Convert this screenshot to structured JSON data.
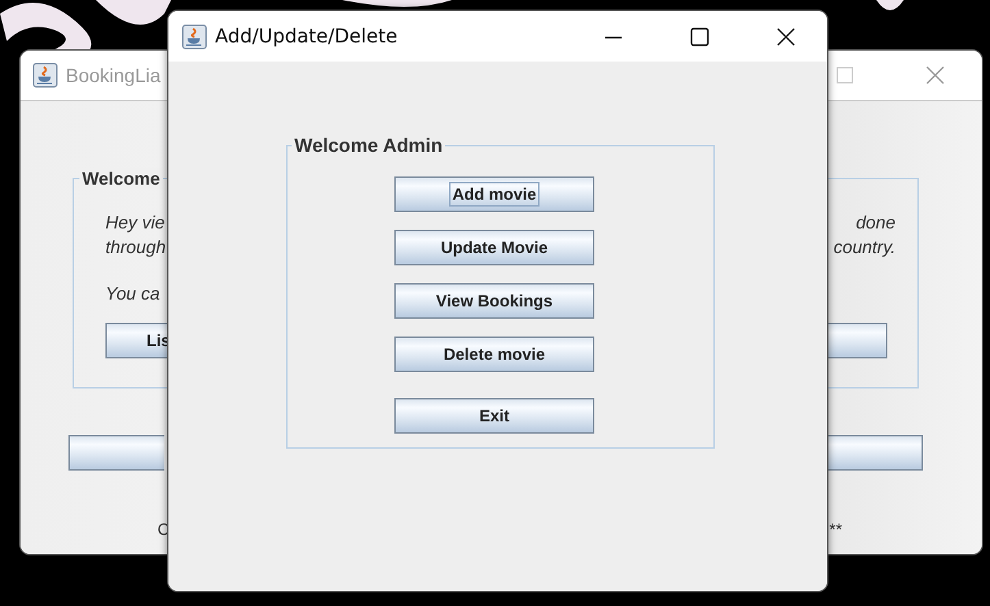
{
  "back_window": {
    "title": "BookingLia",
    "group_title": "Welcome",
    "lines": [
      {
        "left": "Hey vie",
        "right": "done"
      },
      {
        "left": "through",
        "right": "country."
      },
      {
        "left": "You ca"
      }
    ],
    "list_button": "Lis",
    "footer_left": "C",
    "footer_right": "**"
  },
  "front_window": {
    "title": "Add/Update/Delete",
    "group_title": "Welcome Admin",
    "buttons": [
      {
        "label": "Add movie",
        "focused": true
      },
      {
        "label": "Update Movie",
        "focused": false
      },
      {
        "label": "View Bookings",
        "focused": false
      },
      {
        "label": "Delete movie",
        "focused": false
      },
      {
        "label": "Exit",
        "focused": false
      }
    ]
  }
}
